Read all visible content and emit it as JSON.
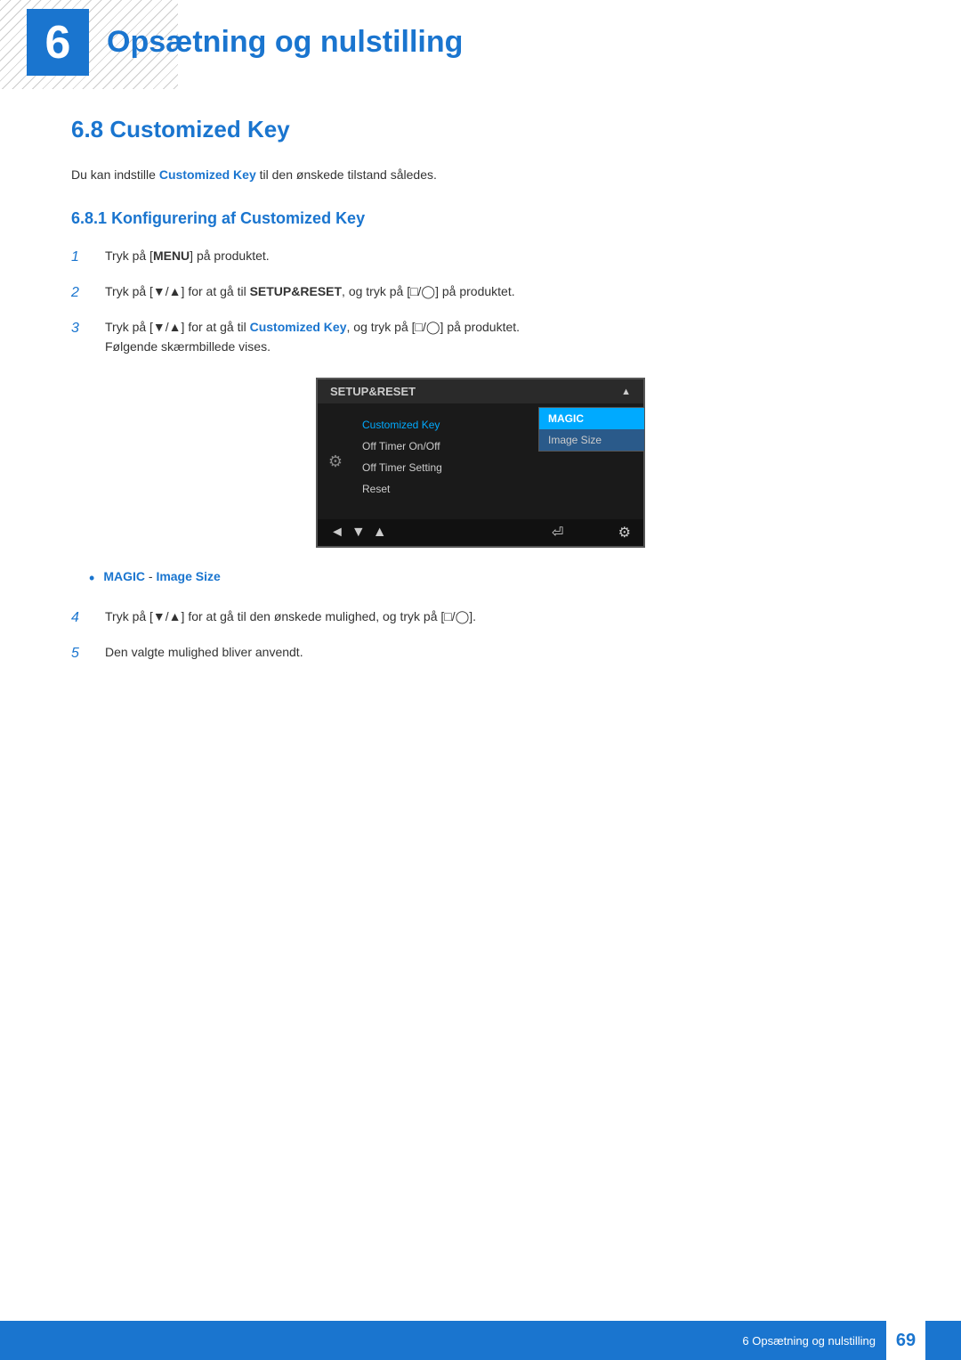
{
  "header": {
    "chapter_number": "6",
    "chapter_title": "Opsætning og nulstilling"
  },
  "section": {
    "number": "6.8",
    "title": "Customized Key"
  },
  "intro": {
    "text_before": "Du kan indstille ",
    "keyword": "Customized Key",
    "text_after": " til den ønskede tilstand således."
  },
  "subsection": {
    "number": "6.8.1",
    "title": "Konfigurering af Customized Key"
  },
  "steps": [
    {
      "number": "1",
      "parts": [
        {
          "text": "Tryk på [",
          "style": "normal"
        },
        {
          "text": "MENU",
          "style": "bold"
        },
        {
          "text": "] på produktet.",
          "style": "normal"
        }
      ]
    },
    {
      "number": "2",
      "parts": [
        {
          "text": "Tryk på [▼/▲] for at gå til ",
          "style": "normal"
        },
        {
          "text": "SETUP&RESET",
          "style": "bold"
        },
        {
          "text": ", og tryk på [⊡/⊜] på produktet.",
          "style": "normal"
        }
      ]
    },
    {
      "number": "3",
      "parts": [
        {
          "text": "Tryk på [▼/▲] for at gå til ",
          "style": "normal"
        },
        {
          "text": "Customized Key",
          "style": "blue-bold"
        },
        {
          "text": ", og tryk på [⊡/⊜] på produktet.",
          "style": "normal"
        }
      ]
    }
  ],
  "step3_subtext": "Følgende skærmbillede vises.",
  "menu": {
    "title": "SETUP&RESET",
    "items": [
      {
        "label": "Customized Key",
        "active": true
      },
      {
        "label": "Off Timer On/Off",
        "active": false
      },
      {
        "label": "Off Timer Setting",
        "active": false
      },
      {
        "label": "Reset",
        "active": false
      }
    ],
    "submenu": [
      {
        "label": "MAGIC",
        "selected": true
      },
      {
        "label": "Image Size",
        "selected": false
      }
    ]
  },
  "bullet": {
    "text_blue": "MAGIC",
    "separator": " - ",
    "text_blue2": "Image Size"
  },
  "steps_4_5": [
    {
      "number": "4",
      "parts": [
        {
          "text": "Tryk på [▼/▲] for at gå til den ønskede mulighed, og tryk på [⊡/⊜].",
          "style": "normal"
        }
      ]
    },
    {
      "number": "5",
      "parts": [
        {
          "text": "Den valgte mulighed bliver anvendt.",
          "style": "normal"
        }
      ]
    }
  ],
  "footer": {
    "text": "6 Opsætning og nulstilling",
    "page_number": "69"
  }
}
